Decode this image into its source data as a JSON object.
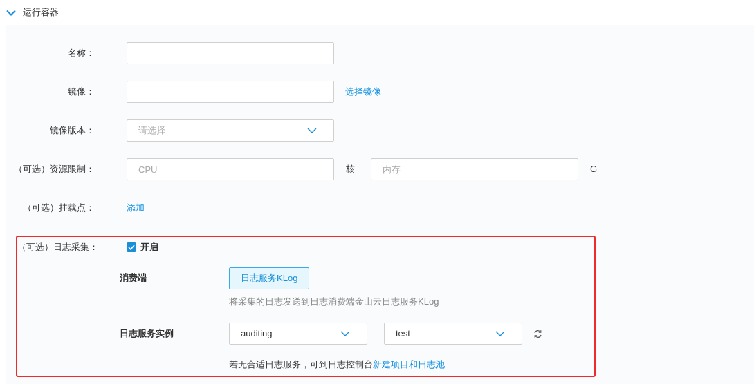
{
  "section": {
    "title": "运行容器",
    "expanded": true
  },
  "fields": [
    {
      "kind": "input",
      "label": "名称："
    },
    {
      "kind": "input",
      "label": "镜像：",
      "link": "选择镜像"
    },
    {
      "kind": "select",
      "label": "镜像版本：",
      "placeholder": "请选择"
    },
    {
      "kind": "resource",
      "label": "（可选）资源限制：",
      "cpu_placeholder": "CPU",
      "cpu_unit": "核",
      "memory_placeholder": "内存",
      "memory_unit": "G"
    },
    {
      "kind": "link",
      "label": "（可选）挂载点：",
      "link": "添加"
    }
  ],
  "log_collection": {
    "label": "（可选）日志采集：",
    "enable": {
      "label": "开启",
      "checked": true
    },
    "consumer": {
      "label": "消费端",
      "options": [
        {
          "label": "日志服务KLog",
          "selected": true
        }
      ],
      "description": "将采集的日志发送到日志消费端金山云日志服务KLog"
    },
    "instance": {
      "label": "日志服务实例",
      "selects": [
        {
          "value": "auditing"
        },
        {
          "value": "test"
        }
      ]
    },
    "hint": {
      "text": "若无合适日志服务，可到日志控制台",
      "link": "新建项目和日志池"
    }
  }
}
